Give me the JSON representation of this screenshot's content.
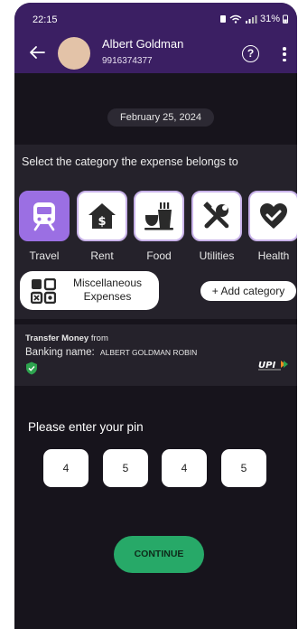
{
  "status_bar": {
    "time": "22:15",
    "battery": "31%"
  },
  "header": {
    "contact_name": "Albert Goldman",
    "contact_phone": "9916374377",
    "help_label": "?"
  },
  "date_chip": "February 25, 2024",
  "category_section": {
    "prompt": "Select the category the expense belongs to",
    "categories": [
      {
        "label": "Travel",
        "icon": "train-icon",
        "selected": true
      },
      {
        "label": "Rent",
        "icon": "house-rupee-icon",
        "selected": false
      },
      {
        "label": "Food",
        "icon": "food-icon",
        "selected": false
      },
      {
        "label": "Utilities",
        "icon": "tools-icon",
        "selected": false
      },
      {
        "label": "Health",
        "icon": "heart-check-icon",
        "selected": false
      }
    ],
    "misc_line1": "Miscellaneous",
    "misc_line2": "Expenses",
    "add_category": "+ Add category"
  },
  "banking": {
    "transfer_bold": "Transfer Money",
    "transfer_rest": " from",
    "banking_label": "Banking name:",
    "banking_name": "ALBERT GOLDMAN ROBIN",
    "logo": "UPI"
  },
  "pin": {
    "prompt": "Please enter your pin",
    "digits": [
      "4",
      "5",
      "4",
      "5"
    ]
  },
  "continue_label": "CONTINUE",
  "colors": {
    "header": "#3b1f63",
    "accent": "#9b6fe3",
    "continue": "#27a968",
    "background": "#17141c"
  }
}
